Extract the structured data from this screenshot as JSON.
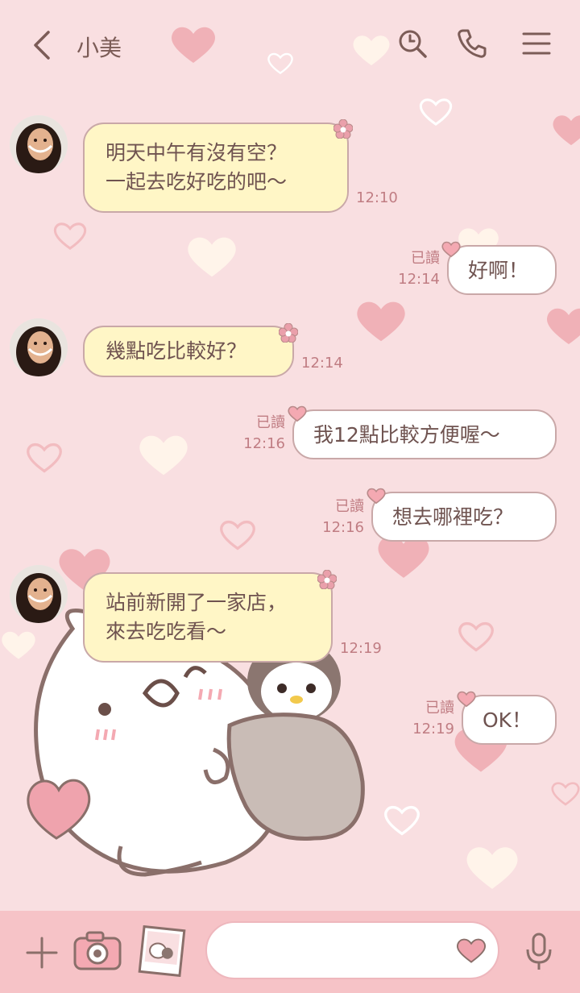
{
  "header": {
    "title": "小美"
  },
  "messages": [
    {
      "direction": "in",
      "text": "明天中午有沒有空？\n一起去吃好吃的吧～",
      "time": "12:10"
    },
    {
      "direction": "out",
      "text": "好啊！",
      "read": "已讀",
      "time": "12:14"
    },
    {
      "direction": "in",
      "text": "幾點吃比較好？",
      "time": "12:14"
    },
    {
      "direction": "out",
      "text": "我12點比較方便喔～",
      "read": "已讀",
      "time": "12:16"
    },
    {
      "direction": "out",
      "text": "想去哪裡吃？",
      "read": "已讀",
      "time": "12:16"
    },
    {
      "direction": "in",
      "text": "站前新開了一家店，\n來去吃吃看～",
      "time": "12:19"
    },
    {
      "direction": "out",
      "text": "OK！",
      "read": "已讀",
      "time": "12:19"
    }
  ],
  "input": {
    "placeholder": ""
  },
  "colors": {
    "background": "#f9dfe1",
    "incoming_bubble": "#fff6c6",
    "outgoing_bubble": "#ffffff",
    "bubble_border": "#c9a8a8",
    "text": "#6f5350",
    "timestamp": "#c07d83",
    "bottom_bar": "#f6c3c7"
  },
  "icons": [
    "back-icon",
    "search-icon",
    "phone-icon",
    "menu-icon",
    "plus-icon",
    "camera-icon",
    "sticker-photo-icon",
    "heart-emoji-icon",
    "microphone-icon",
    "flower-icon",
    "heart-icon"
  ]
}
